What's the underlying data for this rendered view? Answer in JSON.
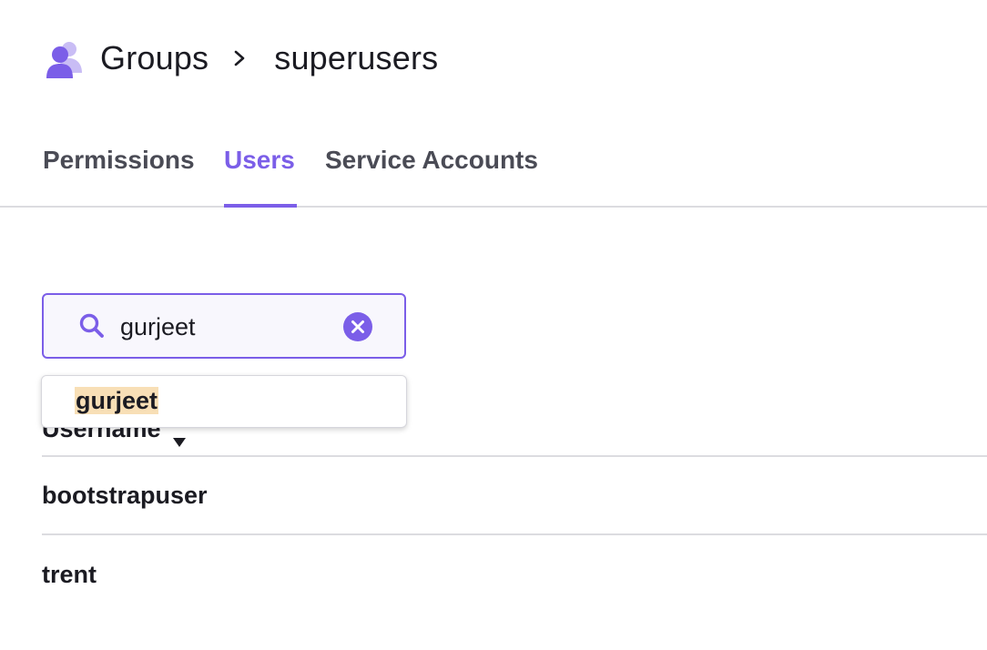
{
  "breadcrumb": {
    "root_label": "Groups",
    "current_label": "superusers",
    "icon": "group-users-icon"
  },
  "tabs": [
    {
      "label": "Permissions",
      "active": false
    },
    {
      "label": "Users",
      "active": true
    },
    {
      "label": "Service Accounts",
      "active": false
    }
  ],
  "search": {
    "value": "gurjeet",
    "icon": "search-icon",
    "clear_icon": "clear-icon"
  },
  "autocomplete": {
    "suggestions": [
      "gurjeet"
    ]
  },
  "table": {
    "column_header": "Username",
    "sort_icon": "caret-down-icon",
    "rows": [
      "bootstrapuser",
      "trent"
    ]
  },
  "colors": {
    "accent": "#7b5ee8",
    "highlight": "#f8dfb6",
    "divider": "#dcdce0"
  }
}
